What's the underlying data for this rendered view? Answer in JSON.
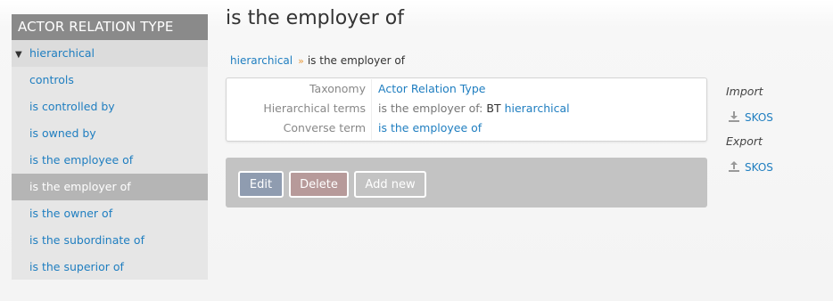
{
  "sidebar": {
    "header": "ACTOR RELATION TYPE",
    "parent": "hierarchical",
    "items": [
      "controls",
      "is controlled by",
      "is owned by",
      "is the employee of",
      "is the employer of",
      "is the owner of",
      "is the subordinate of",
      "is the superior of"
    ]
  },
  "main": {
    "title": "is the employer of",
    "breadcrumb": {
      "parent": "hierarchical",
      "separator": "»",
      "current": "is the employer of"
    },
    "info": {
      "taxonomy_label": "Taxonomy",
      "taxonomy_value": "Actor Relation Type",
      "hierarchical_label": "Hierarchical terms",
      "hierarchical_prefix": "is the employer of:",
      "hierarchical_bt": "BT",
      "hierarchical_value": "hierarchical",
      "converse_label": "Converse term",
      "converse_value": "is the employee of"
    },
    "buttons": {
      "edit": "Edit",
      "delete": "Delete",
      "add_new": "Add new"
    }
  },
  "actions": {
    "import_heading": "Import",
    "import_link": "SKOS",
    "import_icon": "download-icon",
    "export_heading": "Export",
    "export_link": "SKOS",
    "export_icon": "upload-icon"
  },
  "colors": {
    "link": "#1f7ec0",
    "sidebar_header": "#8a8a8a",
    "active_item": "#b5b5b5",
    "edit_button": "#8f9cb0",
    "delete_button": "#b79a9a"
  }
}
